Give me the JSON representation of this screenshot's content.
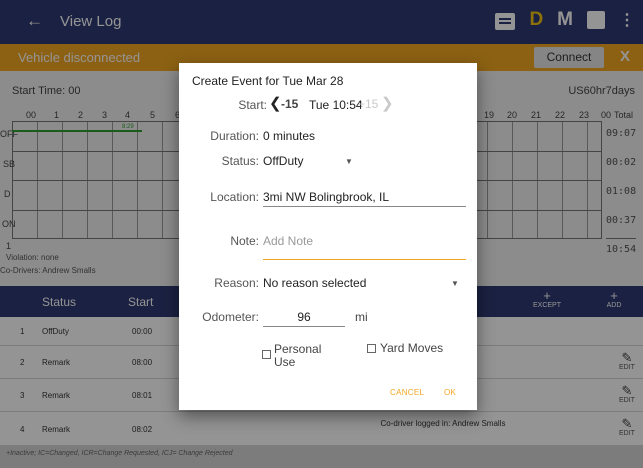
{
  "appbar": {
    "back_icon": "arrow-left-icon",
    "title": "View Log",
    "icons": [
      "message-icon",
      "d-status-icon",
      "m-status-icon",
      "device-icon",
      "more-vert-icon"
    ],
    "d_label": "D",
    "m_label": "M",
    "menu_glyph": "⋮",
    "color": "#2f3a73"
  },
  "status_bar": {
    "text": "Vehicle disconnected",
    "connect_label": "Connect",
    "close_label": "X",
    "color": "#f2a722"
  },
  "graph": {
    "start_time": "Start Time: 00",
    "cycle": "US60hr7days",
    "hours_left": [
      "00",
      "1",
      "2",
      "3",
      "4",
      "5",
      "6"
    ],
    "hours_right": [
      "19",
      "20",
      "21",
      "22",
      "23",
      "00"
    ],
    "total_label": "Total",
    "rows": [
      "OFF",
      "SB",
      "D",
      "ON"
    ],
    "totals": [
      "09:07",
      "00:02",
      "01:08",
      "00:37"
    ],
    "sum": "10:54",
    "marker": "8:29",
    "bottom_tick": "1",
    "violation": "Violation: none",
    "co_drivers": "Co-Drivers: Andrew Smalls"
  },
  "log_table": {
    "headers": [
      "Status",
      "Start"
    ],
    "except_label": "EXCEPT",
    "add_label": "ADD",
    "plus": "+",
    "edit_label": "EDIT",
    "rows": [
      {
        "num": "1",
        "status": "OffDuty",
        "start": "00:00",
        "note": ""
      },
      {
        "num": "2",
        "status": "Remark",
        "start": "08:00",
        "note": ""
      },
      {
        "num": "3",
        "status": "Remark",
        "start": "08:01",
        "note": ""
      },
      {
        "num": "4",
        "status": "Remark",
        "start": "08:02",
        "note": "Co-driver logged in: Andrew Smalls"
      }
    ],
    "footnote": "+Inactive; IC=Changed, ICR=Change Requested, ICJ= Change Rejected"
  },
  "dialog": {
    "title": "Create Event for Tue Mar 28",
    "start_label": "Start:",
    "minus_label": "-15",
    "start_value": "Tue 10:54",
    "plus_label": "+15",
    "duration_label": "Duration:",
    "duration_value": "0 minutes",
    "status_label": "Status:",
    "status_value": "OffDuty",
    "location_label": "Location:",
    "location_value": "3mi NW Bolingbrook, IL",
    "note_label": "Note:",
    "note_placeholder": "Add Note",
    "reason_label": "Reason:",
    "reason_value": "No reason selected",
    "odometer_label": "Odometer:",
    "odometer_value": "96",
    "odometer_unit": "mi",
    "personal_use_label": "Personal Use",
    "personal_use_checked": false,
    "yard_moves_label": "Yard Moves",
    "yard_moves_checked": false,
    "cancel_label": "CANCEL",
    "ok_label": "OK",
    "accent": "#f2a722"
  }
}
